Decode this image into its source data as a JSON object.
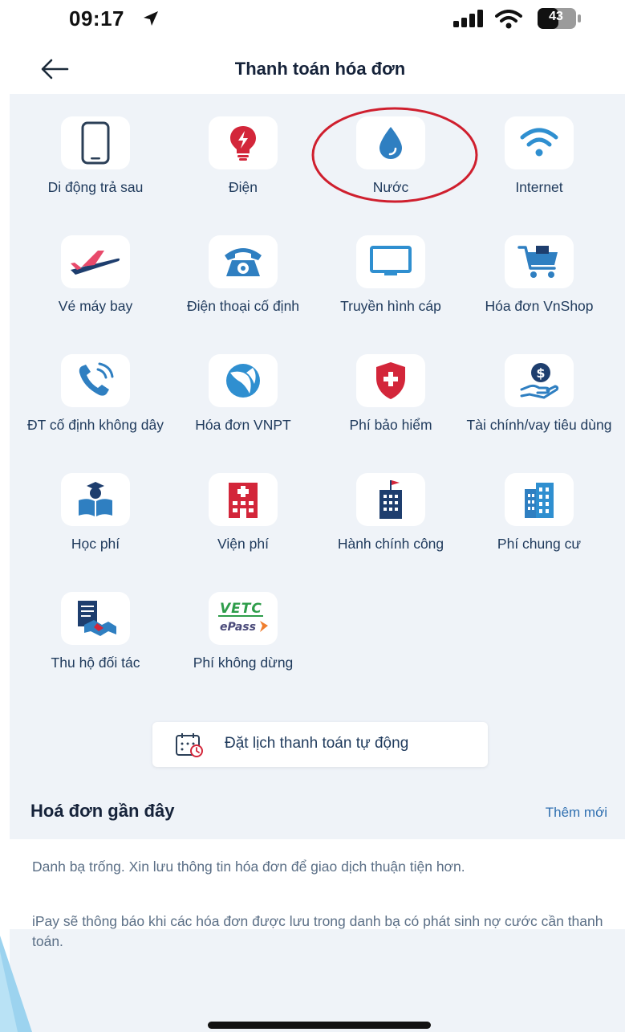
{
  "status_bar": {
    "time": "09:17",
    "battery": "43"
  },
  "header": {
    "title": "Thanh toán hóa đơn"
  },
  "services": [
    {
      "label": "Di động trả sau",
      "icon": "phone-icon"
    },
    {
      "label": "Điện",
      "icon": "electricity-icon"
    },
    {
      "label": "Nước",
      "icon": "water-drop-icon"
    },
    {
      "label": "Internet",
      "icon": "wifi-icon"
    },
    {
      "label": "Vé máy bay",
      "icon": "airplane-icon"
    },
    {
      "label": "Điện thoại cố định",
      "icon": "landline-phone-icon"
    },
    {
      "label": "Truyền hình cáp",
      "icon": "tv-icon"
    },
    {
      "label": "Hóa đơn VnShop",
      "icon": "shopping-cart-icon"
    },
    {
      "label": "ĐT cố định không dây",
      "icon": "wireless-phone-icon"
    },
    {
      "label": "Hóa đơn VNPT",
      "icon": "vnpt-logo-icon"
    },
    {
      "label": "Phí bảo hiểm",
      "icon": "insurance-shield-icon"
    },
    {
      "label": "Tài chính/vay tiêu dùng",
      "icon": "finance-loan-icon"
    },
    {
      "label": "Học phí",
      "icon": "tuition-book-icon"
    },
    {
      "label": "Viện phí",
      "icon": "hospital-icon"
    },
    {
      "label": "Hành chính công",
      "icon": "government-building-icon"
    },
    {
      "label": "Phí chung cư",
      "icon": "apartment-icon"
    },
    {
      "label": "Thu hộ đối tác",
      "icon": "partner-handshake-icon"
    },
    {
      "label": "Phí không dừng",
      "icon": "vetc-epass-logo-icon"
    }
  ],
  "vetc_logo": {
    "line1": "VETC",
    "line2": "ePass"
  },
  "schedule_button": {
    "label": "Đặt lịch thanh toán tự động"
  },
  "recent": {
    "title": "Hoá đơn gần đây",
    "add_label": "Thêm mới",
    "empty_line1": "Danh bạ trống. Xin lưu thông tin hóa đơn để giao dịch thuận tiện hơn.",
    "empty_line2": "iPay sẽ thông báo khi các hóa đơn được lưu trong danh bạ có phát sinh nợ cước cần thanh toán."
  },
  "colors": {
    "primary_blue": "#2f7fc1",
    "red": "#d3263a",
    "highlight_circle": "#cf1f2e",
    "background": "#eff3f8"
  }
}
